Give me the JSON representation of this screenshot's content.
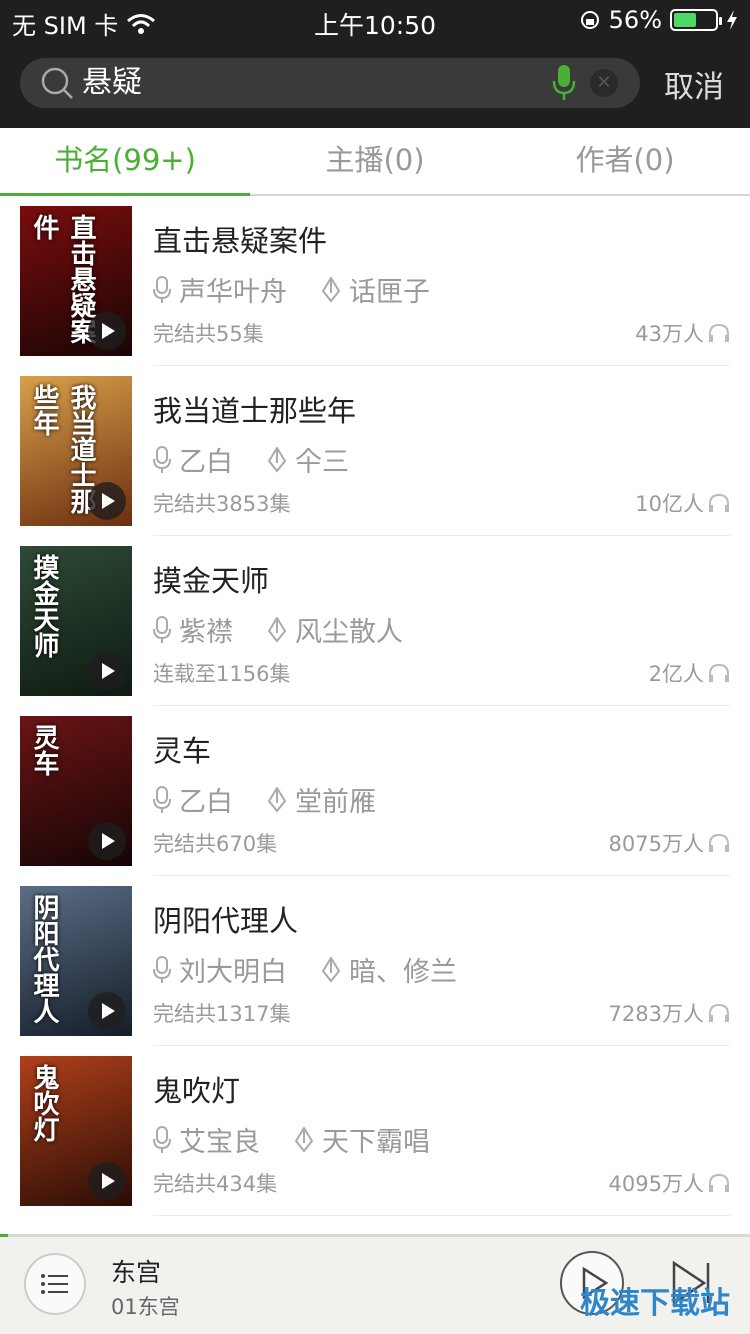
{
  "status_bar": {
    "carrier": "无 SIM 卡",
    "time": "上午10:50",
    "battery_percent": "56%",
    "battery_level": 0.56
  },
  "search": {
    "query": "悬疑",
    "cancel_label": "取消"
  },
  "tabs": [
    {
      "label": "书名(99+)",
      "active": true
    },
    {
      "label": "主播(0)",
      "active": false
    },
    {
      "label": "作者(0)",
      "active": false
    }
  ],
  "books": [
    {
      "title": "直击悬疑案件",
      "narrator": "声华叶舟",
      "author": "话匣子",
      "status": "完结共55集",
      "plays": "43万人",
      "cover_text": "直击悬疑案件",
      "cover_colors": [
        "#7a0d0d",
        "#1a0505"
      ]
    },
    {
      "title": "我当道士那些年",
      "narrator": "乙白",
      "author": "仐三",
      "status": "完结共3853集",
      "plays": "10亿人",
      "cover_text": "我当道士那些年",
      "cover_colors": [
        "#d9a04a",
        "#6b2e10"
      ]
    },
    {
      "title": "摸金天师",
      "narrator": "紫襟",
      "author": "风尘散人",
      "status": "连载至1156集",
      "plays": "2亿人",
      "cover_text": "摸金天师",
      "cover_colors": [
        "#2e4a36",
        "#0e1a12"
      ]
    },
    {
      "title": "灵车",
      "narrator": "乙白",
      "author": "堂前雁",
      "status": "完结共670集",
      "plays": "8075万人",
      "cover_text": "灵车",
      "cover_colors": [
        "#6b1414",
        "#150505"
      ]
    },
    {
      "title": "阴阳代理人",
      "narrator": "刘大明白",
      "author": "暗、修兰",
      "status": "完结共1317集",
      "plays": "7283万人",
      "cover_text": "阴阳代理人",
      "cover_colors": [
        "#5b6e86",
        "#151d28"
      ]
    },
    {
      "title": "鬼吹灯",
      "narrator": "艾宝良",
      "author": "天下霸唱",
      "status": "完结共434集",
      "plays": "4095万人",
      "cover_text": "鬼吹灯",
      "cover_colors": [
        "#b0401a",
        "#2a0c05"
      ]
    }
  ],
  "now_playing": {
    "title": "东宫",
    "subtitle": "01东宫"
  },
  "watermark": "极速下载站",
  "colors": {
    "accent": "#4caf35",
    "header_bg": "#1f1f1f"
  },
  "icons": [
    "search-icon",
    "mic-icon",
    "clear-icon",
    "narrator-mic-icon",
    "author-pen-icon",
    "headphones-icon",
    "play-icon",
    "playlist-icon",
    "next-track-icon",
    "wifi-icon",
    "orientation-lock-icon",
    "charging-icon"
  ]
}
